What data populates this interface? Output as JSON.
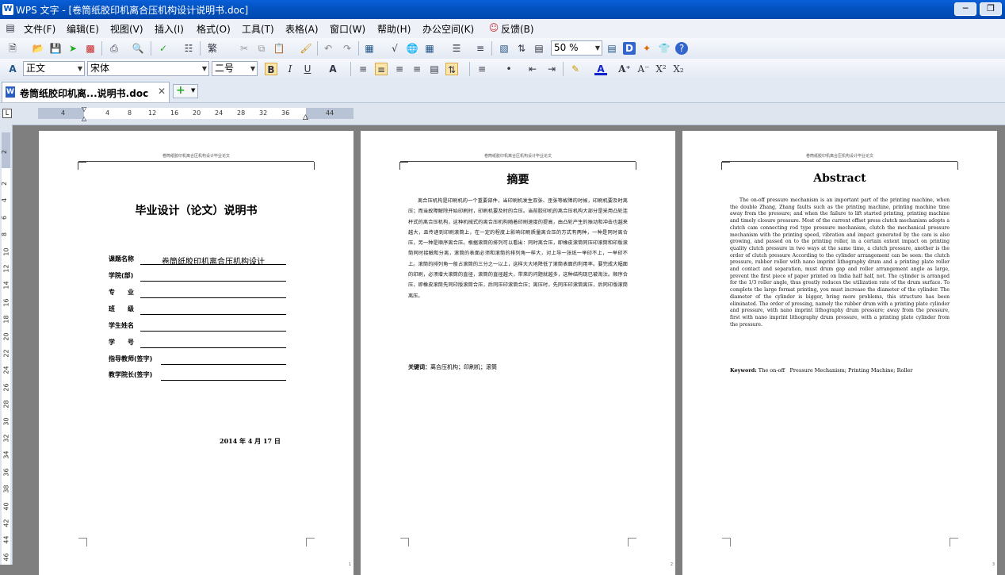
{
  "titlebar": {
    "app": "WPS 文字",
    "title": "WPS 文字 - [卷筒纸胶印机离合压机构设计说明书.doc]"
  },
  "menu": [
    "文件(F)",
    "编辑(E)",
    "视图(V)",
    "插入(I)",
    "格式(O)",
    "工具(T)",
    "表格(A)",
    "窗口(W)",
    "帮助(H)",
    "办公空间(K)",
    "反馈(B)"
  ],
  "toolbar": {
    "zoom": "50 %",
    "style": "正文",
    "font": "宋体",
    "size": "二号"
  },
  "tab": {
    "label": "卷筒纸胶印机离...说明书.doc"
  },
  "ruler": {
    "h_numbers": [
      "4",
      "4",
      "8",
      "12",
      "16",
      "20",
      "24",
      "28",
      "32",
      "36",
      "44"
    ],
    "v_numbers": [
      "2",
      "2",
      "4",
      "6",
      "8",
      "10",
      "12",
      "14",
      "16",
      "18",
      "20",
      "22",
      "24",
      "26",
      "28",
      "30",
      "32",
      "34",
      "36",
      "38",
      "40",
      "42",
      "44",
      "46"
    ]
  },
  "pages": {
    "header_text": "卷筒纸胶印机离合压机构设计毕业论文",
    "cover": {
      "title": "毕业设计（论文）说明书",
      "fields": [
        {
          "label": "课题名称",
          "value": "卷筒纸胶印机离合压机构设计"
        },
        {
          "label": "学院(部)",
          "value": ""
        },
        {
          "label": "专　　业",
          "value": ""
        },
        {
          "label": "班　　级",
          "value": ""
        },
        {
          "label": "学生姓名",
          "value": ""
        },
        {
          "label": "学　　号",
          "value": ""
        },
        {
          "label": "指导教师(签字)",
          "value": ""
        },
        {
          "label": "教学院长(签字)",
          "value": ""
        }
      ],
      "date": "2014 年  4 月 17 日",
      "page_number": "1"
    },
    "zh": {
      "title": "摘要",
      "body": "离合压机构是印刷机的一个重要部件，当印刷机发生双张、歪张等故障的时候，印刷机要及时离压；而当故障解除开始印刷时，印刷机要及时的合压。当前胶印机的离合压机构大部分是采用凸轮连杆式的离合压机构，这种机械式的离合压机构随着印刷速度的提高，由凸轮产生的振动和冲击也越来越大，且传递到印刷滚筒上，在一定的程度上影响印刷质量离合压的方式有两种，一种是同时离合压，另一种是顺序离合压。根据滚筒的排列可以看出：同时离合压，即橡皮滚筒同压印滚筒和印版滚筒同时接触和分离，滚筒的表面必须和滚筒的排列角一样大，对上导一张纸一举印不上，一举印不上。滚筒的排列角一般占滚筒的三分之一以上，这样大大地降低了滚筒表面的利用率。要完成大幅面的印刷，必须增大滚筒的直径，滚筒的直径越大，带来的问题就越多，这种结构现已被淘汰。顺序合压，即橡皮滚筒先同印版滚筒合压，后同压印滚筒合压；离压时，先同压印滚筒离压，后同印版滚筒离压。",
      "keywords_label": "关键词：",
      "keywords": "离合压机构；印刷机；滚筒",
      "page_number": "2"
    },
    "en": {
      "title": "Abstract",
      "body": "The on-off pressure mechanism is an important part of the printing machine, when the double Zhang, Zhang faults such as the printing machine, printing machine time away from the pressure; and when the failure to lift started printing, printing machine and timely closure pressure. Most of the current offset press clutch mechanism adopts a clutch cam connecting rod type pressure mechanism, clutch the mechanical pressure mechanism with the printing speed, vibration and impact generated by the cam is also growing, and passed on to the printing roller, in a certain extent impact on printing quality clutch pressure in two ways at the same time, a clutch pressure, another is the order of clutch pressure According to the cylinder arrangement can be seen: the clutch pressure, rubber roller with nano imprint lithography drum and a printing plate roller and contact and separation, must drum gap and roller arrangement angle as large, prevent the first piece of paper printed on India half half, not. The cylinder is arranged for the 1/3 roller angle, thus greatly reduces the utilization rate of the drum surface. To complete the large format printing, you must increase the diameter of the cylinder. The diameter of the cylinder is bigger, bring more problems, this structure has been eliminated. The order of pressing, namely the rubber drum with a printing plate cylinder and pressure, with nano imprint lithography drum pressure; away from the pressure, first with nano imprint lithography drum pressure, with a printing plate cylinder from the pressure.",
      "keywords_label": "Keyword:",
      "keywords": "The on-off　Pressure Mechanism; Printing Machine; Roller",
      "page_number": "3"
    }
  }
}
